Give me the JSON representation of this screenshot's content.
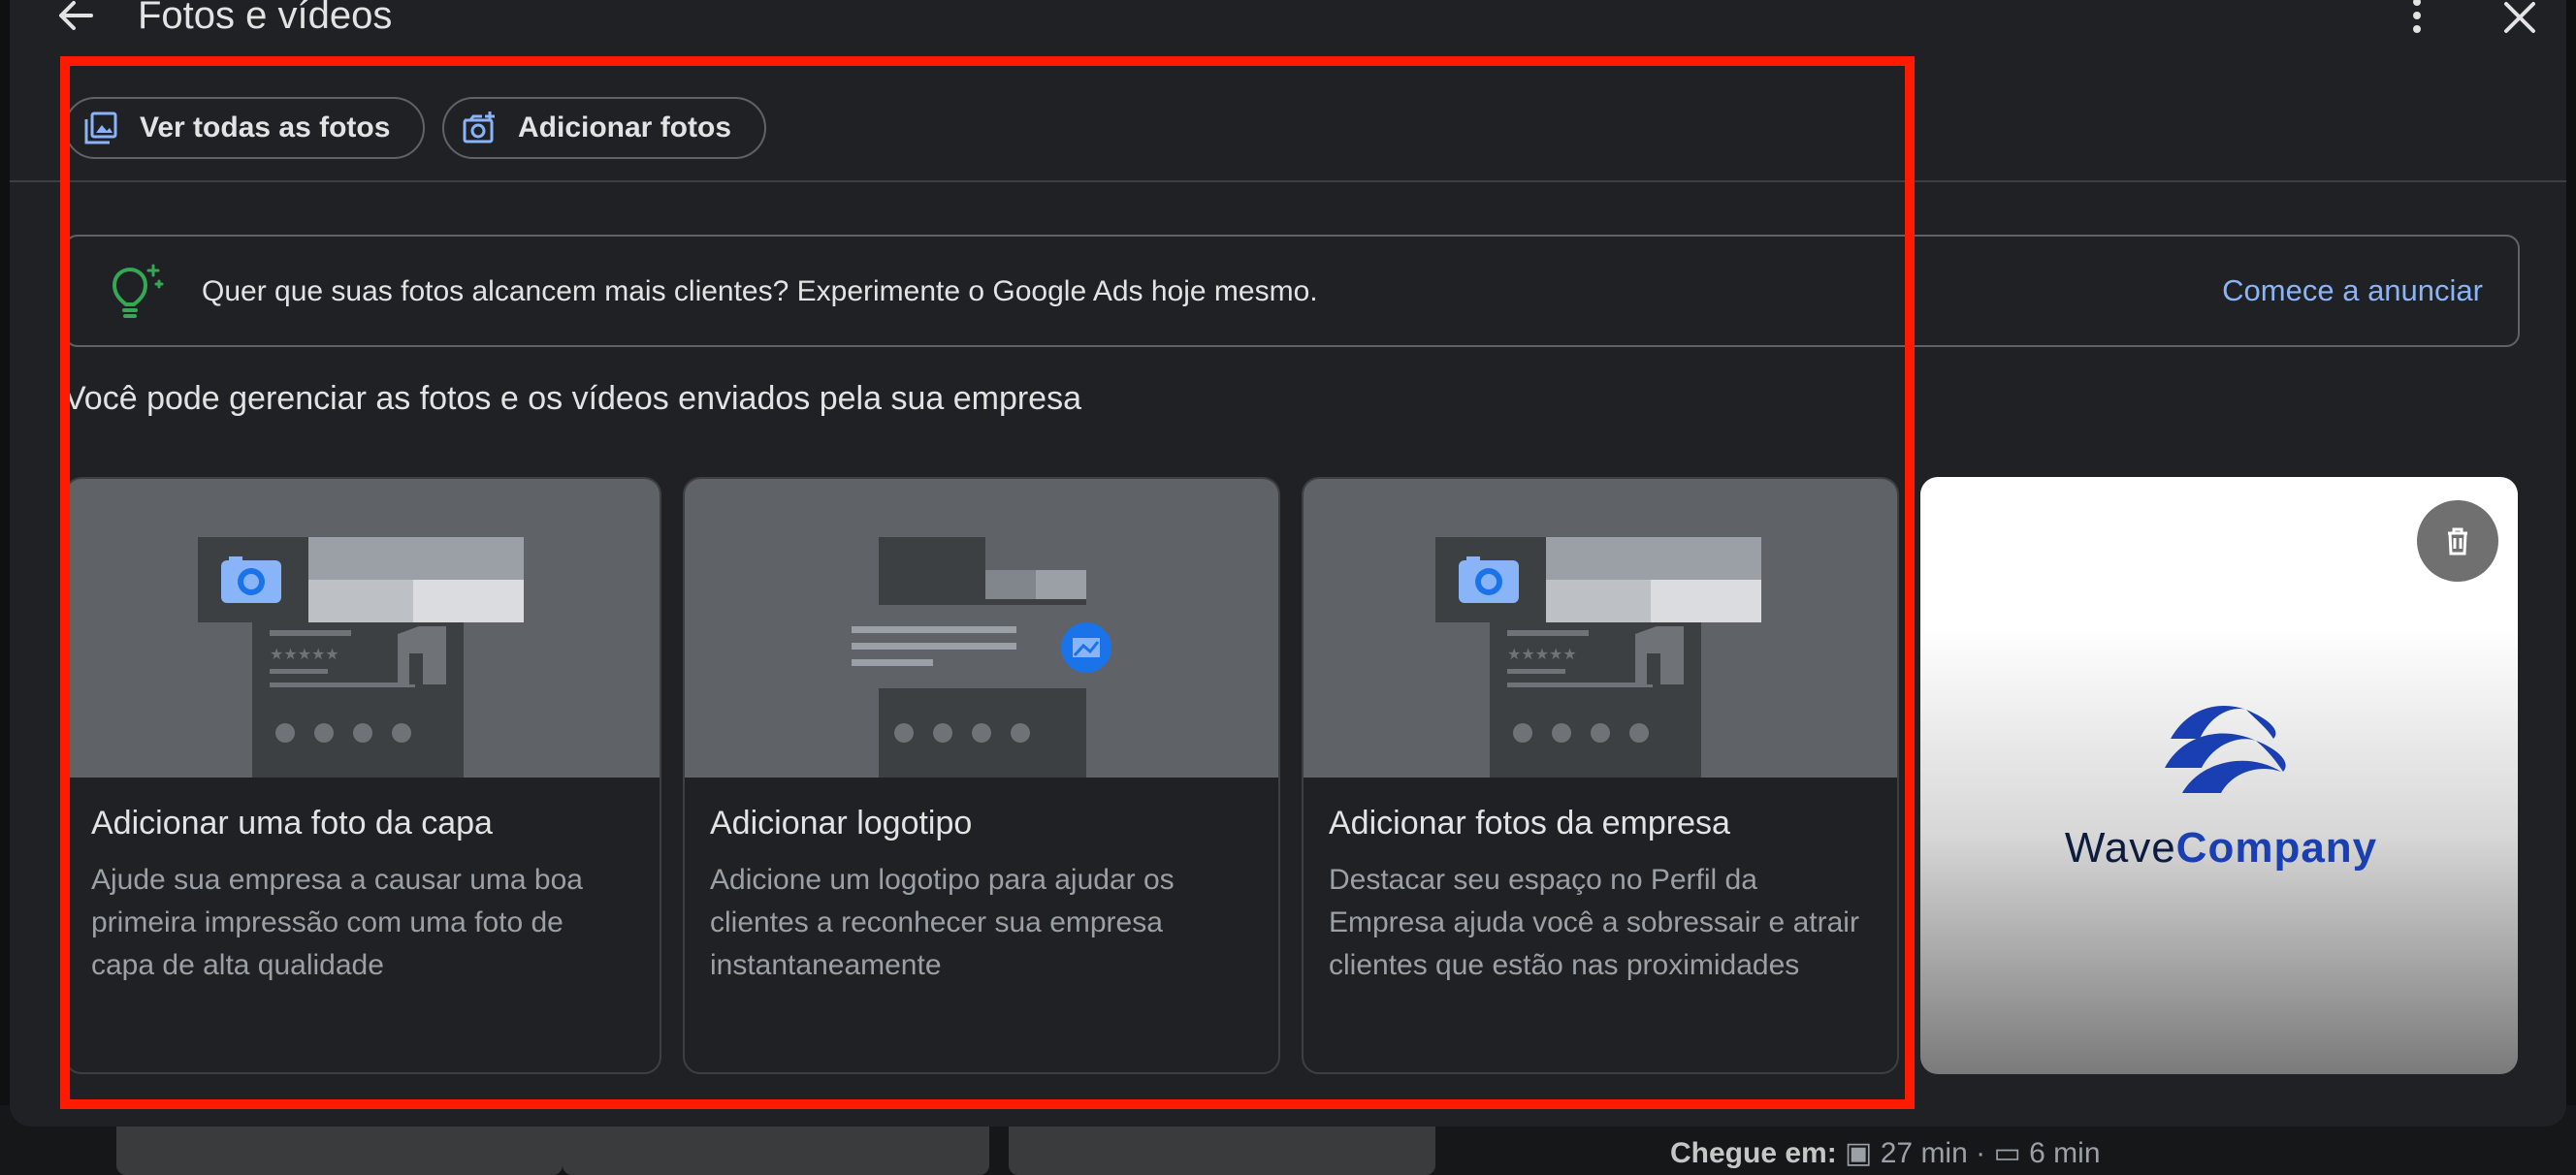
{
  "window": {
    "title": "Fotos e vídeos"
  },
  "header": {
    "back_icon": "arrow-left-icon",
    "more_icon": "more-vert-icon",
    "close_icon": "close-icon"
  },
  "actions": {
    "view_all": {
      "label": "Ver todas as fotos",
      "icon": "photo-library-icon"
    },
    "add_photos": {
      "label": "Adicionar fotos",
      "icon": "add-photo-icon"
    }
  },
  "banner": {
    "icon": "lightbulb-icon",
    "message": "Quer que suas fotos alcancem mais clientes? Experimente o Google Ads hoje mesmo.",
    "cta": "Comece a anunciar"
  },
  "section": {
    "subtitle": "Você pode gerenciar as fotos e os vídeos enviados pela sua empresa"
  },
  "cards": [
    {
      "title": "Adicionar uma foto da capa",
      "description": "Ajude sua empresa a causar uma boa primeira impressão com uma foto de capa de alta qualidade"
    },
    {
      "title": "Adicionar logotipo",
      "description": "Adicione um logotipo para ajudar os clientes a reconhecer sua empresa instantaneamente"
    },
    {
      "title": "Adicionar fotos da empresa",
      "description": "Destacar seu espaço no Perfil da Empresa ajuda você a sobressair e atrair clientes que estão nas proximidades"
    }
  ],
  "uploaded_photo": {
    "logo_word1": "Wave",
    "logo_word2": "Company",
    "delete_icon": "trash-icon"
  },
  "background": {
    "arrive_label": "Chegue em:",
    "transit_time": "27 min",
    "drive_time": "6 min",
    "separator": "·"
  },
  "colors": {
    "accent_link": "#8ab4f8",
    "highlight": "#ff1a00",
    "bulb": "#34a853",
    "logo_blue": "#1a3fb3"
  }
}
